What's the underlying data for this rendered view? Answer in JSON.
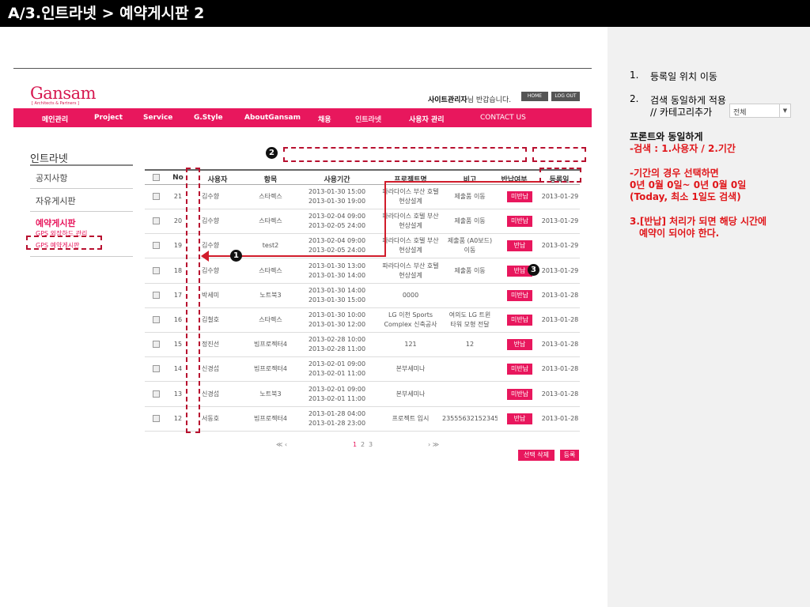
{
  "slide_title": "A/3.인트라넷 > 예약게시판 2",
  "site": {
    "logo": "Gansam",
    "logo_sub": "[ Architects & Partners ]",
    "welcome_name": "사이트관리자",
    "welcome_rest": "님 반갑습니다.",
    "home_btn": "HOME",
    "logout_btn": "LOG OUT"
  },
  "nav": [
    "메인관리",
    "Project",
    "Service",
    "G.Style",
    "AboutGansam",
    "채용",
    "인트라넷",
    "사용자 관리",
    "CONTACT US"
  ],
  "sidebar": {
    "title": "인트라넷",
    "items": [
      "공지사항",
      "자유게시판",
      "예약게시판"
    ],
    "subitems": [
      "GPS 외장하드 관리",
      "GPS 예약게시판"
    ]
  },
  "markers": [
    "1",
    "2",
    "3"
  ],
  "table": {
    "headers": [
      "No",
      "사용자",
      "항목",
      "사용기간",
      "프로젝트명",
      "비고",
      "반납여부",
      "등록일"
    ],
    "rows": [
      {
        "no": "21",
        "user": "김수향",
        "item": "스타렉스",
        "p1": "2013-01-30 15:00",
        "p2": "2013-01-30 19:00",
        "proj1": "파라다이스 부산 호텔",
        "proj2": "현상설계",
        "note1": "제출품 이동",
        "note2": "",
        "status": "미반납",
        "date": "2013-01-29"
      },
      {
        "no": "20",
        "user": "김수향",
        "item": "스타렉스",
        "p1": "2013-02-04 09:00",
        "p2": "2013-02-05 24:00",
        "proj1": "파라다이스 호텔 부산",
        "proj2": "현상설계",
        "note1": "제출품 이동",
        "note2": "",
        "status": "미반납",
        "date": "2013-01-29"
      },
      {
        "no": "19",
        "user": "김수향",
        "item": "test2",
        "p1": "2013-02-04 09:00",
        "p2": "2013-02-05 24:00",
        "proj1": "파라다이스 호텔 부산",
        "proj2": "현상설계",
        "note1": "제출품 (A0보드)",
        "note2": "이동",
        "status": "반납",
        "date": "2013-01-29"
      },
      {
        "no": "18",
        "user": "김수향",
        "item": "스타렉스",
        "p1": "2013-01-30 13:00",
        "p2": "2013-01-30 14:00",
        "proj1": "파라다이스 부산 호텔",
        "proj2": "현상설계",
        "note1": "제출품 이동",
        "note2": "",
        "status": "반납",
        "date": "2013-01-29"
      },
      {
        "no": "17",
        "user": "박세미",
        "item": "노트북3",
        "p1": "2013-01-30 14:00",
        "p2": "2013-01-30 15:00",
        "proj1": "0000",
        "proj2": "",
        "note1": "",
        "note2": "",
        "status": "미반납",
        "date": "2013-01-28"
      },
      {
        "no": "16",
        "user": "김철호",
        "item": "스타렉스",
        "p1": "2013-01-30 10:00",
        "p2": "2013-01-30 12:00",
        "proj1": "LG 이천 Sports",
        "proj2": "Complex 신축공사",
        "note1": "여의도 LG 트윈",
        "note2": "타워 모형 전달",
        "status": "미반납",
        "date": "2013-01-28"
      },
      {
        "no": "15",
        "user": "정진선",
        "item": "빔프로젝터4",
        "p1": "2013-02-28 10:00",
        "p2": "2013-02-28 11:00",
        "proj1": "121",
        "proj2": "",
        "note1": "12",
        "note2": "",
        "status": "반납",
        "date": "2013-01-28"
      },
      {
        "no": "14",
        "user": "신경섭",
        "item": "빔프로젝터4",
        "p1": "2013-02-01 09:00",
        "p2": "2013-02-01 11:00",
        "proj1": "본부세미나",
        "proj2": "",
        "note1": "",
        "note2": "",
        "status": "미반납",
        "date": "2013-01-28"
      },
      {
        "no": "13",
        "user": "신경섭",
        "item": "노트북3",
        "p1": "2013-02-01 09:00",
        "p2": "2013-02-01 11:00",
        "proj1": "본부세미나",
        "proj2": "",
        "note1": "",
        "note2": "",
        "status": "미반납",
        "date": "2013-01-28"
      },
      {
        "no": "12",
        "user": "서동호",
        "item": "빔프로젝터4",
        "p1": "2013-01-28 04:00",
        "p2": "2013-01-28 23:00",
        "proj1": "프로젝트 입시",
        "proj2": "",
        "note1": "235556321523456",
        "note2": "",
        "status": "반납",
        "date": "2013-01-28"
      }
    ]
  },
  "pager": {
    "prev": "≪ ‹",
    "pages": [
      "1",
      "2",
      "3"
    ],
    "next": "› ≫"
  },
  "buttons": {
    "delete": "선택 삭제",
    "register": "등록"
  },
  "notes": {
    "n1_num": "1.",
    "n1": "등록일 위치 이동",
    "n2_num": "2.",
    "n2": "검색 동일하게 적용",
    "n2b": "// 카테고리추가",
    "select_value": "전체",
    "n3": "프론트와 동일하게",
    "n4": "-검색 : 1.사용자 / 2.기간",
    "n5": "-기간의 경우 선택하면",
    "n6": " 0년 0월 0일~ 0년 0월 0일",
    "n7": "(Today, 최소 1일도 검색)",
    "n8": "3.[반납] 처리가 되면 해당 시간에",
    "n9": "예약이 되어야 한다."
  },
  "colors": {
    "accent": "#e8175d",
    "annotation": "#d11c2b",
    "title_bar": "#000000"
  }
}
